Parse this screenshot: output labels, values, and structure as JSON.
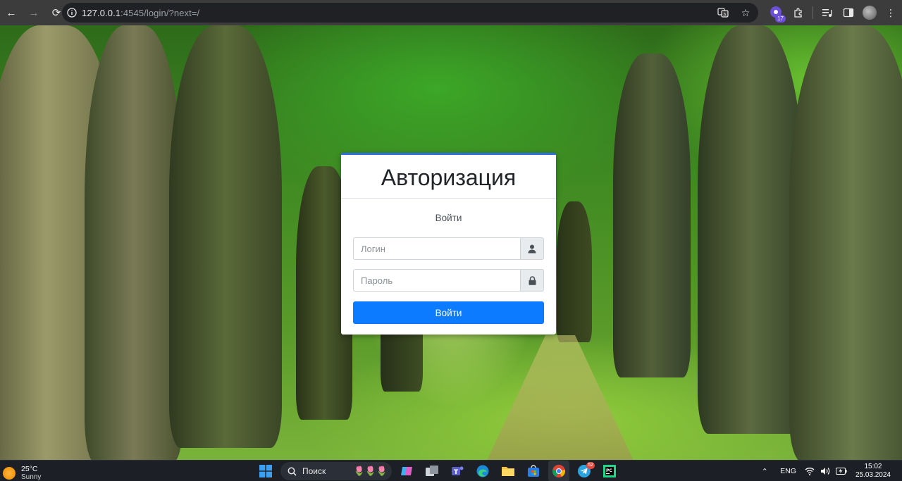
{
  "browser": {
    "url_host": "127.0.0.1",
    "url_path": ":4545/login/?next=/",
    "extension_badge": "17"
  },
  "login": {
    "title": "Авторизация",
    "subtitle": "Войти",
    "username_placeholder": "Логин",
    "password_placeholder": "Пароль",
    "submit_label": "Войти",
    "accent_color": "#0d7bff"
  },
  "taskbar": {
    "weather_temp": "25°C",
    "weather_desc": "Sunny",
    "search_label": "Поиск",
    "telegram_badge": "52",
    "language": "ENG",
    "time": "15:02",
    "date": "25.03.2024"
  }
}
